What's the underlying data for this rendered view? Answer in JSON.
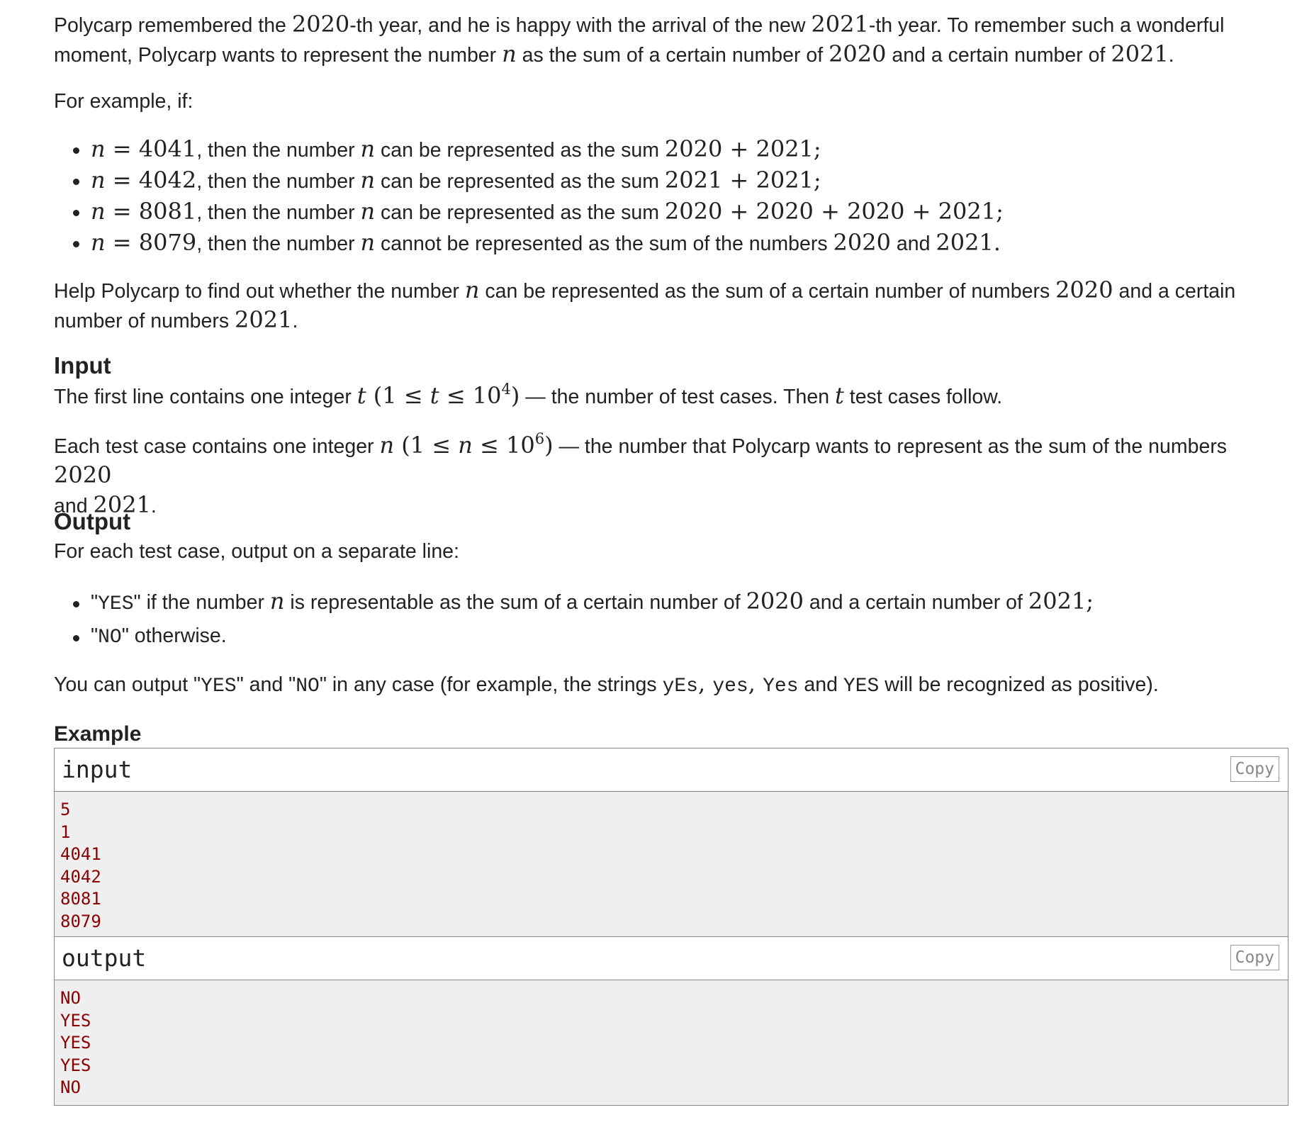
{
  "statement": {
    "p1": {
      "a": "Polycarp remembered the ",
      "y2020": "2020",
      "b": "-th year, and he is happy with the arrival of the new ",
      "y2021": "2021",
      "c": "-th year. To remember such a wonderful moment, Polycarp wants to represent the number ",
      "n": "n",
      "d": " as the sum of a certain number of ",
      "m1": "2020",
      "e": " and a certain number of ",
      "m2": "2021",
      "f": "."
    },
    "p2": "For example, if:",
    "examples": [
      {
        "var": "n",
        "eq": " = 4041",
        "mid": ", then the number ",
        "var2": "n",
        "rest": " can be represented as the sum ",
        "expr": "2020 + 2021",
        "end": ";"
      },
      {
        "var": "n",
        "eq": " = 4042",
        "mid": ", then the number ",
        "var2": "n",
        "rest": " can be represented as the sum ",
        "expr": "2021 + 2021",
        "end": ";"
      },
      {
        "var": "n",
        "eq": " = 8081",
        "mid": ", then the number ",
        "var2": "n",
        "rest": " can be represented as the sum ",
        "expr": "2020 + 2020 + 2020 + 2021",
        "end": ";"
      },
      {
        "var": "n",
        "eq": " = 8079",
        "mid": ", then the number ",
        "var2": "n",
        "rest": " cannot be represented as the sum of the numbers ",
        "expr": "2020",
        "and": " and ",
        "expr2": "2021",
        "end": "."
      }
    ],
    "p3": {
      "a": "Help Polycarp to find out whether the number ",
      "n": "n",
      "b": " can be represented as the sum of a certain number of numbers ",
      "m1": "2020",
      "c": " and a certain number of numbers ",
      "m2": "2021",
      "d": "."
    }
  },
  "input_section": {
    "title": "Input",
    "p1": {
      "a": "The first line contains one integer ",
      "t": "t",
      "range_open": " (1 ≤ ",
      "t2": "t",
      "range_mid": " ≤ 10",
      "exp": "4",
      "range_close": ")",
      "b": " — the number of test cases. Then ",
      "t3": "t",
      "c": " test cases follow."
    },
    "p2": {
      "a": "Each test case contains one integer ",
      "n": "n",
      "range_open": " (1 ≤ ",
      "n2": "n",
      "range_mid": " ≤ 10",
      "exp": "6",
      "range_close": ")",
      "b": " — the number that Polycarp wants to represent as the sum of the numbers ",
      "m1": "2020",
      "c": " and ",
      "m2": "2021",
      "d": "."
    }
  },
  "output_section": {
    "title": "Output",
    "p1": "For each test case, output on a separate line:",
    "items": [
      {
        "q1": "\"",
        "code": "YES",
        "q2": "\"",
        "a": " if the number ",
        "n": "n",
        "b": " is representable as the sum of a certain number of ",
        "m1": "2020",
        "c": " and a certain number of ",
        "m2": "2021",
        "d": ";"
      },
      {
        "q1": "\"",
        "code": "NO",
        "q2": "\"",
        "a": " otherwise."
      }
    ],
    "p2": {
      "a": "You can output \"",
      "c1": "YES",
      "b": "\" and \"",
      "c2": "NO",
      "c": "\" in any case (for example, the strings ",
      "s1": "yEs",
      "sep1": ", ",
      "s2": "yes",
      "sep2": ", ",
      "s3": "Yes",
      "d": " and ",
      "s4": "YES",
      "e": " will be recognized as positive)."
    }
  },
  "example": {
    "title": "Example",
    "input_label": "input",
    "output_label": "output",
    "copy_label": "Copy",
    "input_lines": [
      "5",
      "1",
      "4041",
      "4042",
      "8081",
      "8079"
    ],
    "output_lines": [
      "NO",
      "YES",
      "YES",
      "YES",
      "NO"
    ]
  }
}
